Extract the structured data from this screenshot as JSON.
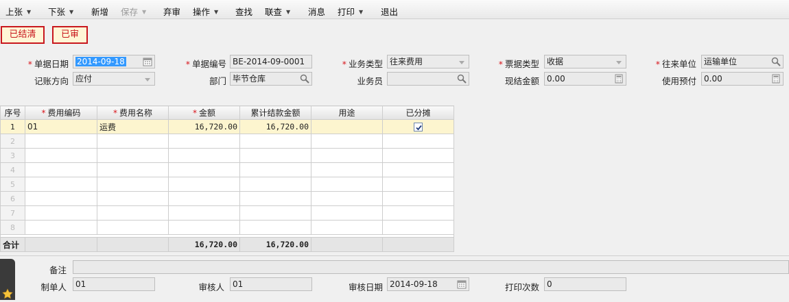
{
  "toolbar": {
    "prev": "上张",
    "next": "下张",
    "new": "新增",
    "save": "保存",
    "abandon": "弃审",
    "operations": "操作",
    "find": "查找",
    "link_query": "联查",
    "messages": "消息",
    "print": "打印",
    "exit": "退出"
  },
  "status": {
    "settled": "已结清",
    "audited": "已审"
  },
  "header": {
    "doc_date_label": "单据日期",
    "doc_date": "2014-09-18",
    "doc_no_label": "单据编号",
    "doc_no": "BE-2014-09-0001",
    "biz_type_label": "业务类型",
    "biz_type": "往来费用",
    "ticket_type_label": "票据类型",
    "ticket_type": "收据",
    "partner_label": "往来单位",
    "partner": "运输单位",
    "direction_label": "记账方向",
    "direction": "应付",
    "dept_label": "部门",
    "dept": "毕节仓库",
    "salesman_label": "业务员",
    "salesman": "",
    "cash_amount_label": "现结金额",
    "cash_amount": "0.00",
    "prepay_label": "使用预付",
    "prepay": "0.00"
  },
  "grid": {
    "columns": [
      "序号",
      "费用编码",
      "费用名称",
      "金额",
      "累计结款金额",
      "用途",
      "已分摊"
    ],
    "rows": [
      {
        "no": "1",
        "code": "01",
        "name": "运费",
        "amount": "16,720.00",
        "settled": "16,720.00",
        "usage": "",
        "allocated": true
      },
      {
        "no": "2",
        "code": "",
        "name": "",
        "amount": "",
        "settled": "",
        "usage": "",
        "allocated": false
      },
      {
        "no": "3",
        "code": "",
        "name": "",
        "amount": "",
        "settled": "",
        "usage": "",
        "allocated": false
      },
      {
        "no": "4",
        "code": "",
        "name": "",
        "amount": "",
        "settled": "",
        "usage": "",
        "allocated": false
      },
      {
        "no": "5",
        "code": "",
        "name": "",
        "amount": "",
        "settled": "",
        "usage": "",
        "allocated": false
      },
      {
        "no": "6",
        "code": "",
        "name": "",
        "amount": "",
        "settled": "",
        "usage": "",
        "allocated": false
      },
      {
        "no": "7",
        "code": "",
        "name": "",
        "amount": "",
        "settled": "",
        "usage": "",
        "allocated": false
      },
      {
        "no": "8",
        "code": "",
        "name": "",
        "amount": "",
        "settled": "",
        "usage": "",
        "allocated": false
      }
    ],
    "total_label": "合计",
    "total_amount": "16,720.00",
    "total_settled": "16,720.00"
  },
  "footer": {
    "remark_label": "备注",
    "remark": "",
    "creator_label": "制单人",
    "creator": "01",
    "auditor_label": "审核人",
    "auditor": "01",
    "audit_date_label": "审核日期",
    "audit_date": "2014-09-18",
    "print_count_label": "打印次数",
    "print_count": "0"
  },
  "colors": {
    "stamp_red": "#c8161d",
    "required_star": "#d8141b",
    "row_highlight": "#fdf5cf",
    "selection_blue": "#3399ff"
  }
}
